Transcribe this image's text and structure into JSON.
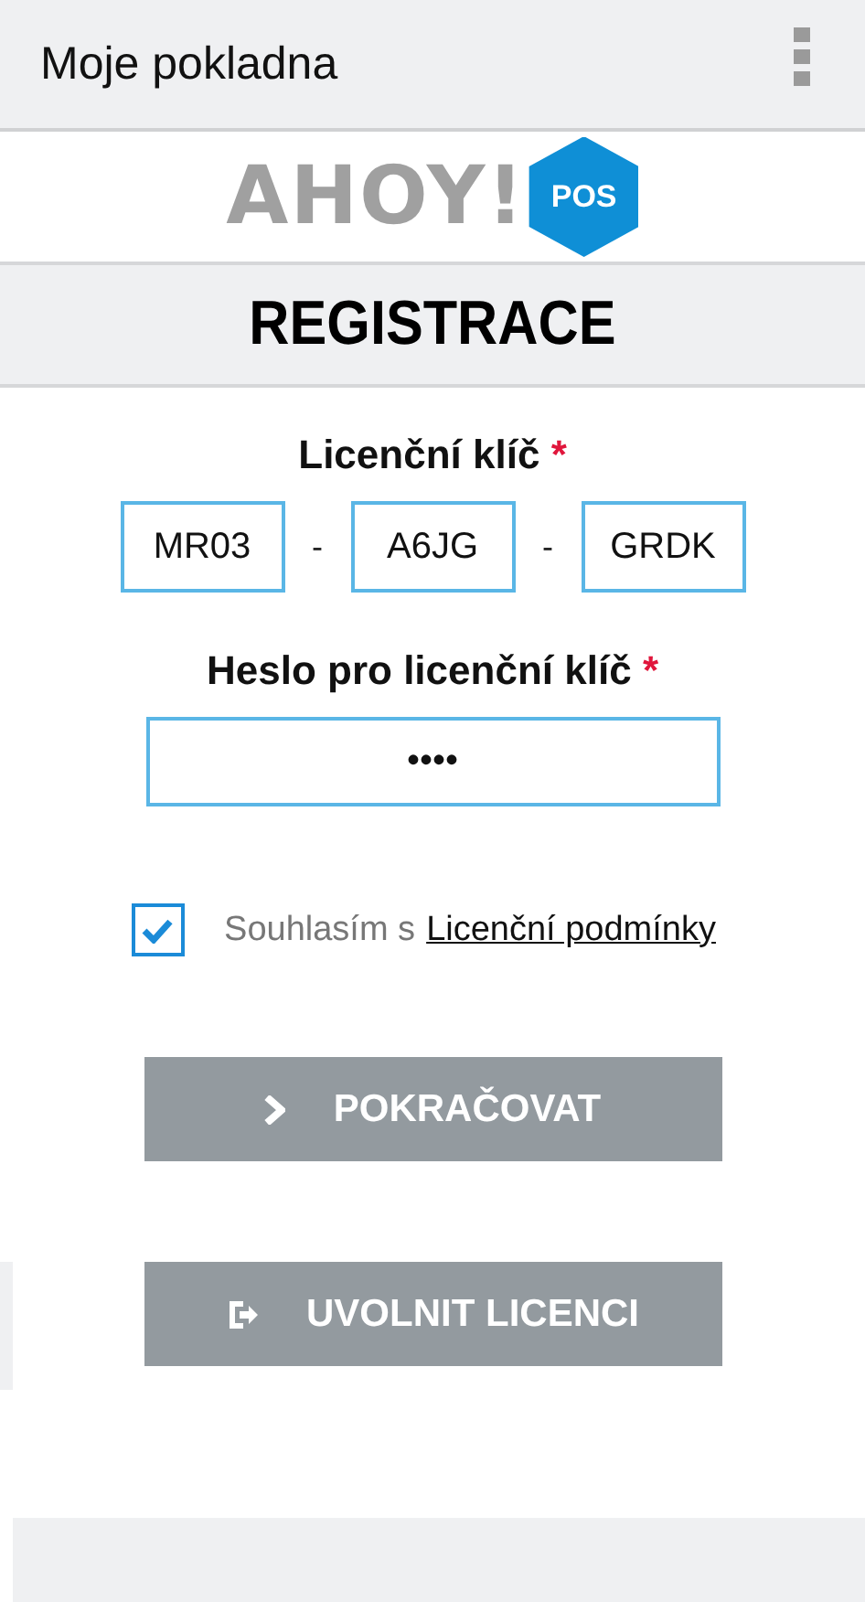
{
  "app_bar": {
    "title": "Moje pokladna"
  },
  "logo": {
    "word": "AHOY!",
    "badge": "POS"
  },
  "heading": "REGISTRACE",
  "license_key": {
    "label": "Licenční klíč",
    "required_mark": "*",
    "parts": [
      "MR03",
      "A6JG",
      "GRDK"
    ],
    "separator": "-"
  },
  "password": {
    "label": "Heslo pro licenční klíč",
    "required_mark": "*",
    "value": "••••"
  },
  "agreement": {
    "checked": true,
    "text": "Souhlasím s",
    "link": "Licenční podmínky"
  },
  "buttons": [
    {
      "kind": "next",
      "label": "POKRAČOVAT"
    },
    {
      "kind": "release",
      "label": "UVOLNIT LICENCI"
    }
  ]
}
